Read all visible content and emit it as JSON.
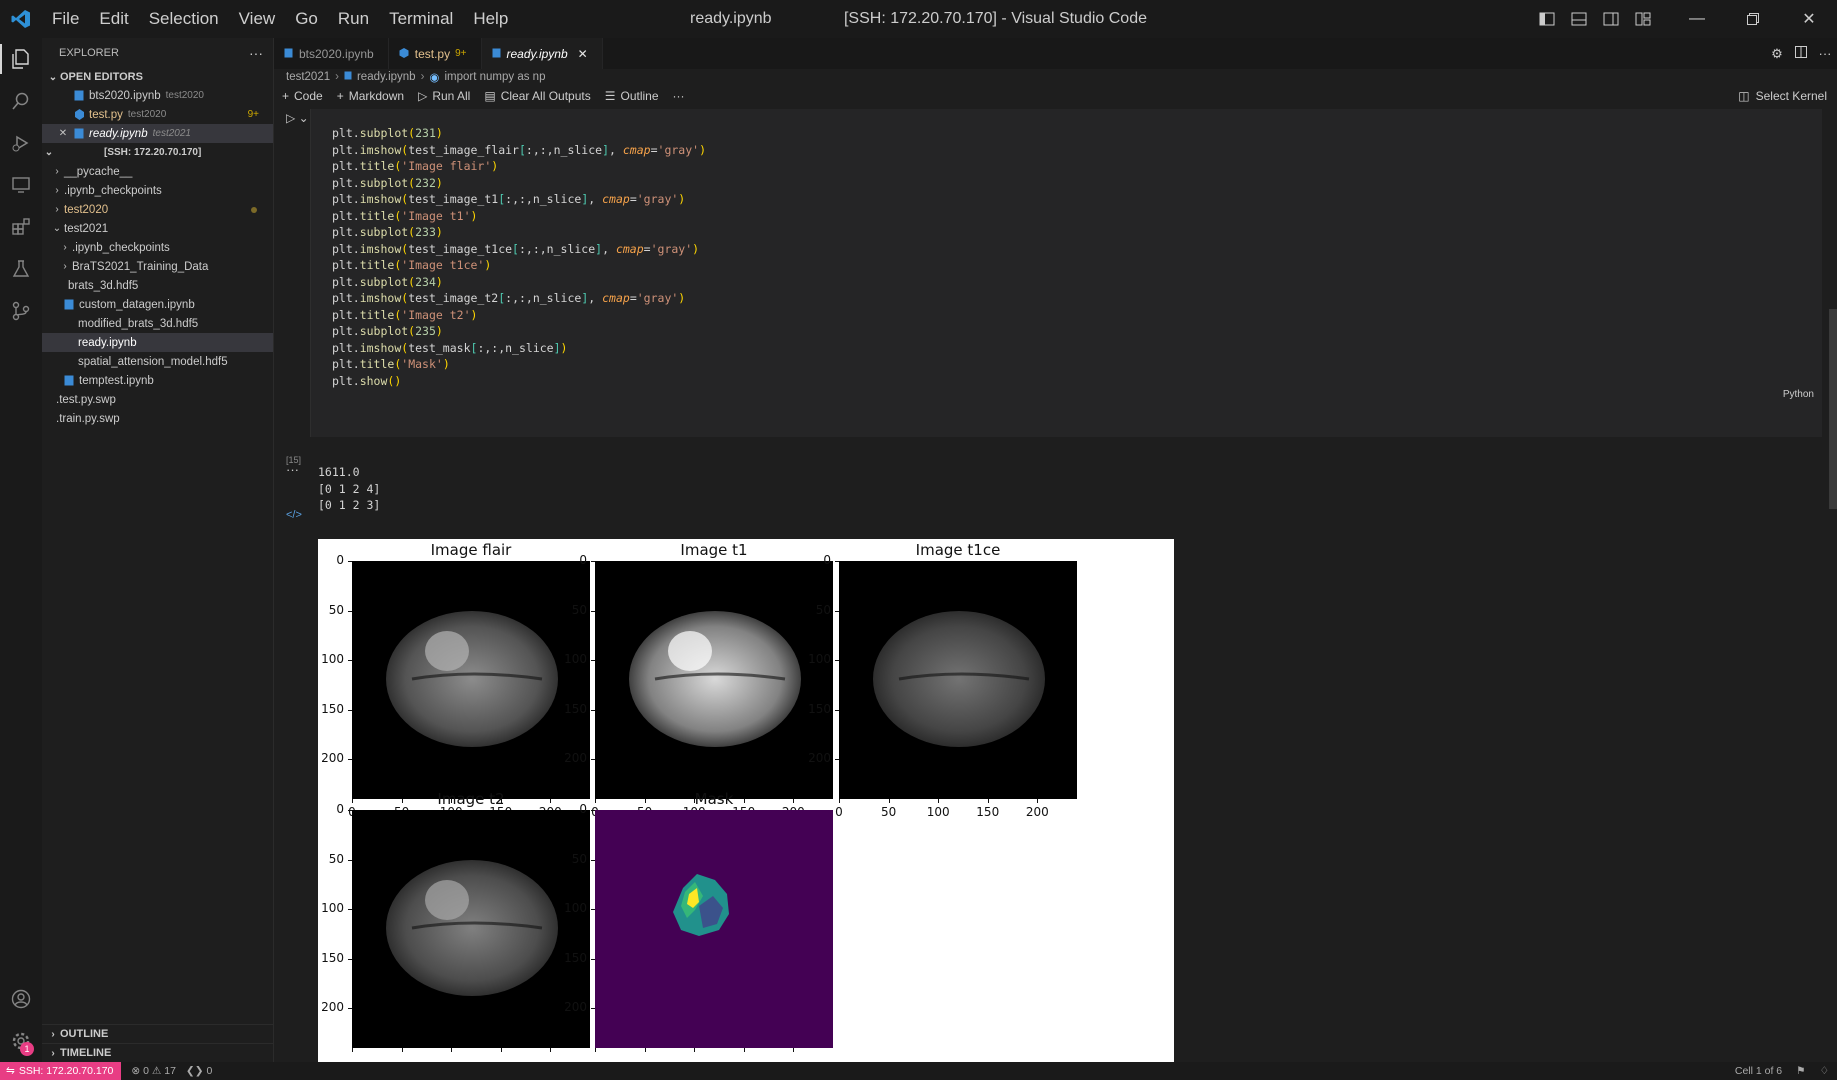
{
  "window": {
    "title_tab": "ready.ipynb",
    "title_rest": "[SSH: 172.20.70.170] - Visual Studio Code"
  },
  "menu": [
    "File",
    "Edit",
    "Selection",
    "View",
    "Go",
    "Run",
    "Terminal",
    "Help"
  ],
  "sidebar": {
    "header": "EXPLORER",
    "open_editors_title": "OPEN EDITORS",
    "open_editors": [
      {
        "name": "bts2020.ipynb",
        "folder": "test2020",
        "badge": ""
      },
      {
        "name": "test.py",
        "folder": "test2020",
        "badge": "9+"
      },
      {
        "name": "ready.ipynb",
        "folder": "test2021",
        "badge": ""
      }
    ],
    "workspace_title": "[SSH: 172.20.70.170]",
    "tree": [
      {
        "name": "__pycache__",
        "type": "folder"
      },
      {
        "name": ".ipynb_checkpoints",
        "type": "folder"
      },
      {
        "name": "test2020",
        "type": "folder"
      },
      {
        "name": "test2021",
        "type": "folder-open"
      },
      {
        "name": ".ipynb_checkpoints",
        "type": "folder"
      },
      {
        "name": "BraTS2021_Training_Data",
        "type": "folder"
      },
      {
        "name": "brats_3d.hdf5",
        "type": "file"
      },
      {
        "name": "custom_datagen.ipynb",
        "type": "notebook"
      },
      {
        "name": "modified_brats_3d.hdf5",
        "type": "file"
      },
      {
        "name": "ready.ipynb",
        "type": "notebook"
      },
      {
        "name": "spatial_attension_model.hdf5",
        "type": "file"
      },
      {
        "name": "temptest.ipynb",
        "type": "notebook"
      },
      {
        "name": ".test.py.swp",
        "type": "file"
      },
      {
        "name": ".train.py.swp",
        "type": "file"
      }
    ],
    "outline": "OUTLINE",
    "timeline": "TIMELINE"
  },
  "tabs": [
    {
      "label": "bts2020.ipynb",
      "mod": ""
    },
    {
      "label": "test.py",
      "mod": "9+"
    },
    {
      "label": "ready.ipynb",
      "mod": ""
    }
  ],
  "breadcrumb": [
    "test2021",
    "ready.ipynb",
    "import numpy as np"
  ],
  "toolbar": {
    "code": "Code",
    "markdown": "Markdown",
    "run_all": "Run All",
    "clear": "Clear All Outputs",
    "outline": "Outline",
    "more": "···",
    "kernel": "Select Kernel"
  },
  "cell": {
    "exec_count": "[15]",
    "language": "Python",
    "output": [
      "1611.0",
      "[0 1 2 4]",
      "[0 1 2 3]"
    ]
  },
  "figure": {
    "subplots": [
      {
        "title": "Image flair"
      },
      {
        "title": "Image t1"
      },
      {
        "title": "Image t1ce"
      },
      {
        "title": "Image t2"
      },
      {
        "title": "Mask"
      }
    ],
    "y_ticks": [
      "0",
      "50",
      "100",
      "150",
      "200"
    ],
    "x_ticks": [
      "0",
      "50",
      "100",
      "150",
      "200"
    ]
  },
  "status": {
    "remote": "SSH: 172.20.70.170",
    "problems": "0",
    "warnings": "17",
    "ports": "0",
    "cell": "Cell 1 of 6"
  },
  "colors": {
    "remote": "#e83d84",
    "mask_bg": "#440154",
    "mask_teal": "#21918c",
    "mask_green": "#35b779",
    "mask_yellow": "#fde725"
  }
}
